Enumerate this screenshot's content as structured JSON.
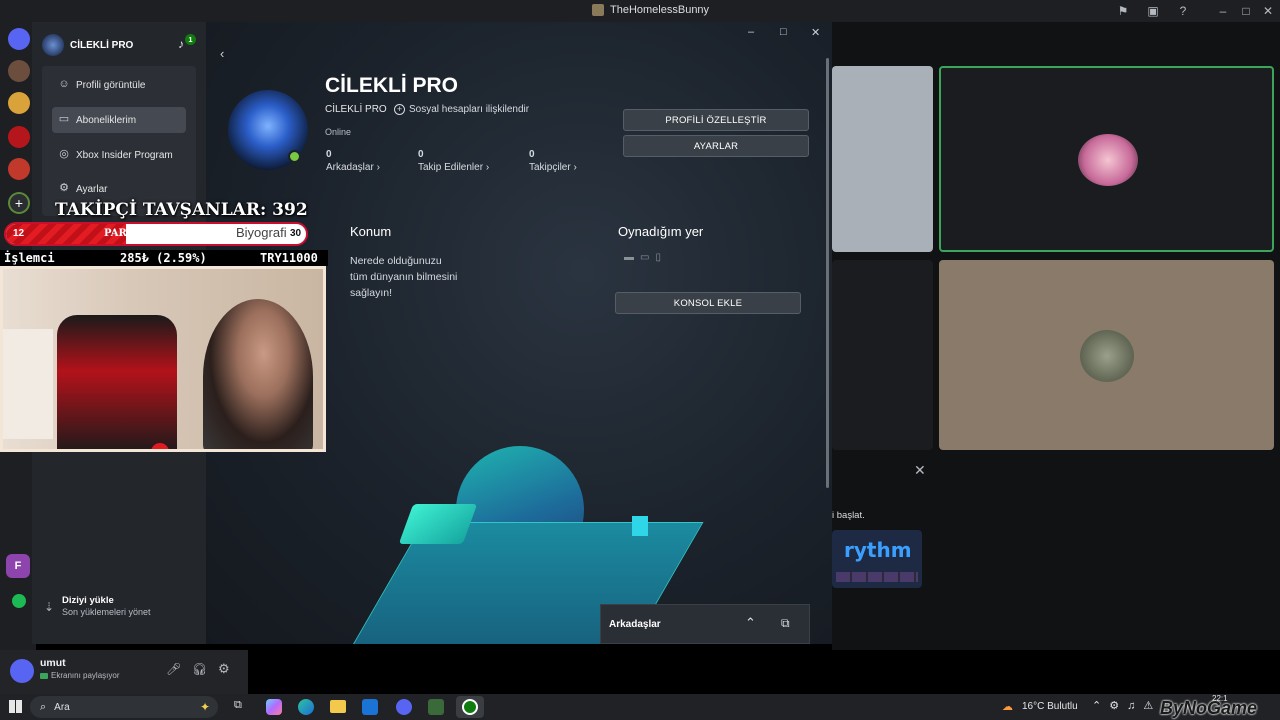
{
  "window": {
    "title": "TheHomelessBunny"
  },
  "xbox": {
    "sidebar": {
      "profile_name": "CİLEKLİ PRO",
      "notif_count": "1",
      "menu": [
        {
          "label": "Profili görüntüle",
          "icon": "user-icon"
        },
        {
          "label": "Aboneliklerim",
          "icon": "card-icon"
        },
        {
          "label": "Xbox Insider Program",
          "icon": "insider-icon"
        },
        {
          "label": "Ayarlar",
          "icon": "gear-icon"
        }
      ],
      "download_title": "Diziyi yükle",
      "download_sub": "Son yüklemeleri yönet"
    },
    "profile": {
      "name": "CİLEKLİ PRO",
      "gamertag": "CİLEKLİ PRO",
      "social_link": "Sosyal hesapları ilişkilendir",
      "status": "Online",
      "stats": [
        {
          "count": "0",
          "label": "Arkadaşlar"
        },
        {
          "count": "0",
          "label": "Takip Edilenler"
        },
        {
          "count": "0",
          "label": "Takipçiler"
        }
      ],
      "customize_btn": "PROFİLİ ÖZELLEŞTİR",
      "settings_btn": "AYARLAR"
    },
    "bio_header": "Biyografi",
    "location": {
      "header": "Konum",
      "text": "Nerede olduğunuzu tüm dünyanın bilmesini sağlayın!"
    },
    "played": {
      "header": "Oynadığım yer",
      "add_console_btn": "KONSOL EKLE"
    },
    "friends_panel": {
      "title": "Arkadaşlar"
    }
  },
  "overlay": {
    "followers": "TAKİPÇİ TAVŞANLAR: 392",
    "paid": {
      "label": "PARALI TAVŞANLAR",
      "left": "12",
      "right": "30",
      "progress": 0.4
    },
    "ticker": {
      "a": "İşlemci",
      "b": "285₺ (2.59%)",
      "c": "TRY11000"
    }
  },
  "discord": {
    "stream_text": "i başlat.",
    "rythm": "rythm",
    "user": {
      "name": "umut",
      "status": "Ekranını paylaşıyor"
    }
  },
  "taskbar": {
    "search": "Ara",
    "weather": "16°C  Bulutlu",
    "time": "22:1",
    "watermark": "ByNoGame"
  }
}
